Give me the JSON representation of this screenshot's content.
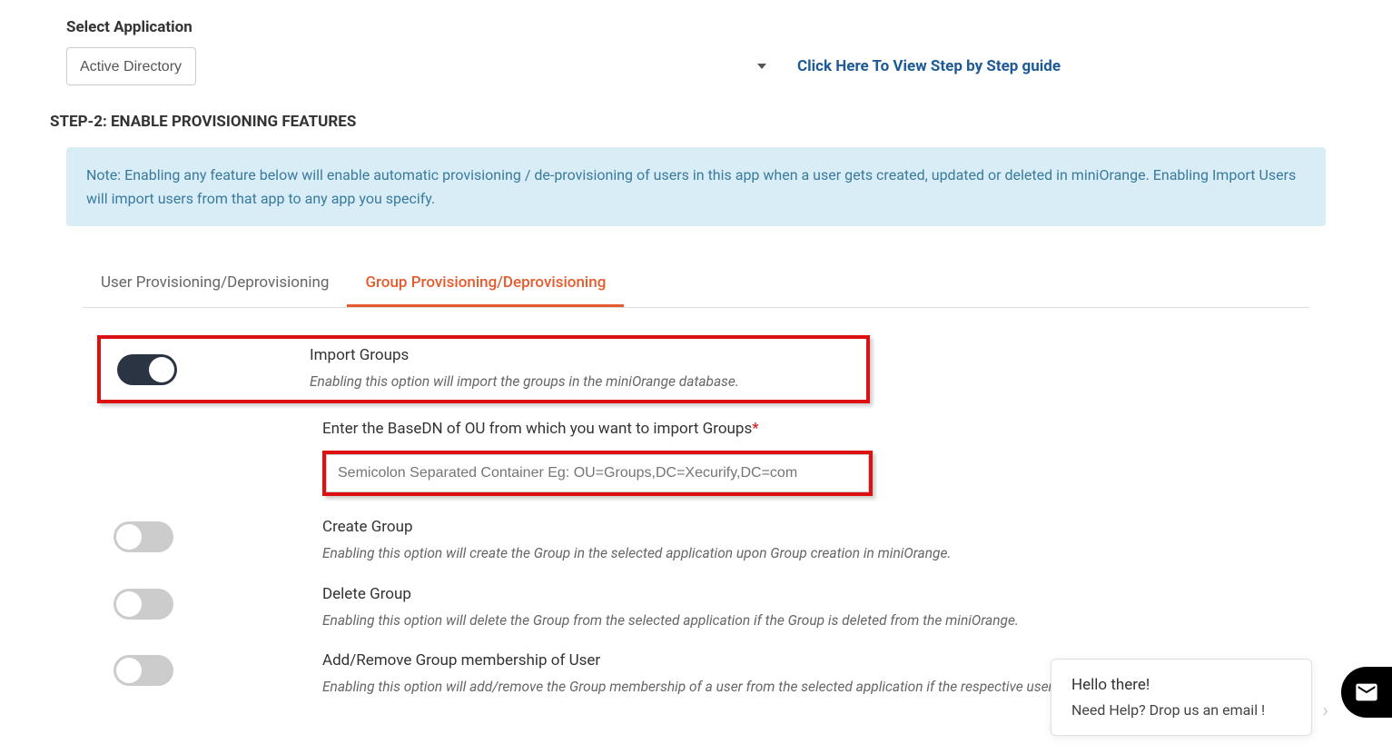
{
  "select_label": "Select Application",
  "select_value": "Active Directory",
  "guide_link": "Click Here To View Step by Step guide",
  "step_heading": "STEP-2: ENABLE PROVISIONING FEATURES",
  "note_text": "Note: Enabling any feature below will enable automatic provisioning / de-provisioning of users in this app when a user gets created, updated or deleted in miniOrange. Enabling Import Users will import users from that app to any app you specify.",
  "tabs": {
    "user": "User Provisioning/Deprovisioning",
    "group": "Group Provisioning/Deprovisioning"
  },
  "features": {
    "import_groups": {
      "title": "Import Groups",
      "desc": "Enabling this option will import the groups in the miniOrange database."
    },
    "basedn": {
      "label": "Enter the BaseDN of OU from which you want to import Groups",
      "placeholder": "Semicolon Separated Container Eg: OU=Groups,DC=Xecurify,DC=com"
    },
    "create_group": {
      "title": "Create Group",
      "desc": "Enabling this option will create the Group in the selected application upon Group creation in miniOrange."
    },
    "delete_group": {
      "title": "Delete Group",
      "desc": "Enabling this option will delete the Group from the selected application if the Group is deleted from the miniOrange."
    },
    "add_remove": {
      "title": "Add/Remove Group membership of User",
      "desc": "Enabling this option will add/remove the Group membership of a user from the selected application if the respective user gets updated from the miniOrange."
    }
  },
  "chat": {
    "line1": "Hello there!",
    "line2": "Need Help? Drop us an email !"
  }
}
